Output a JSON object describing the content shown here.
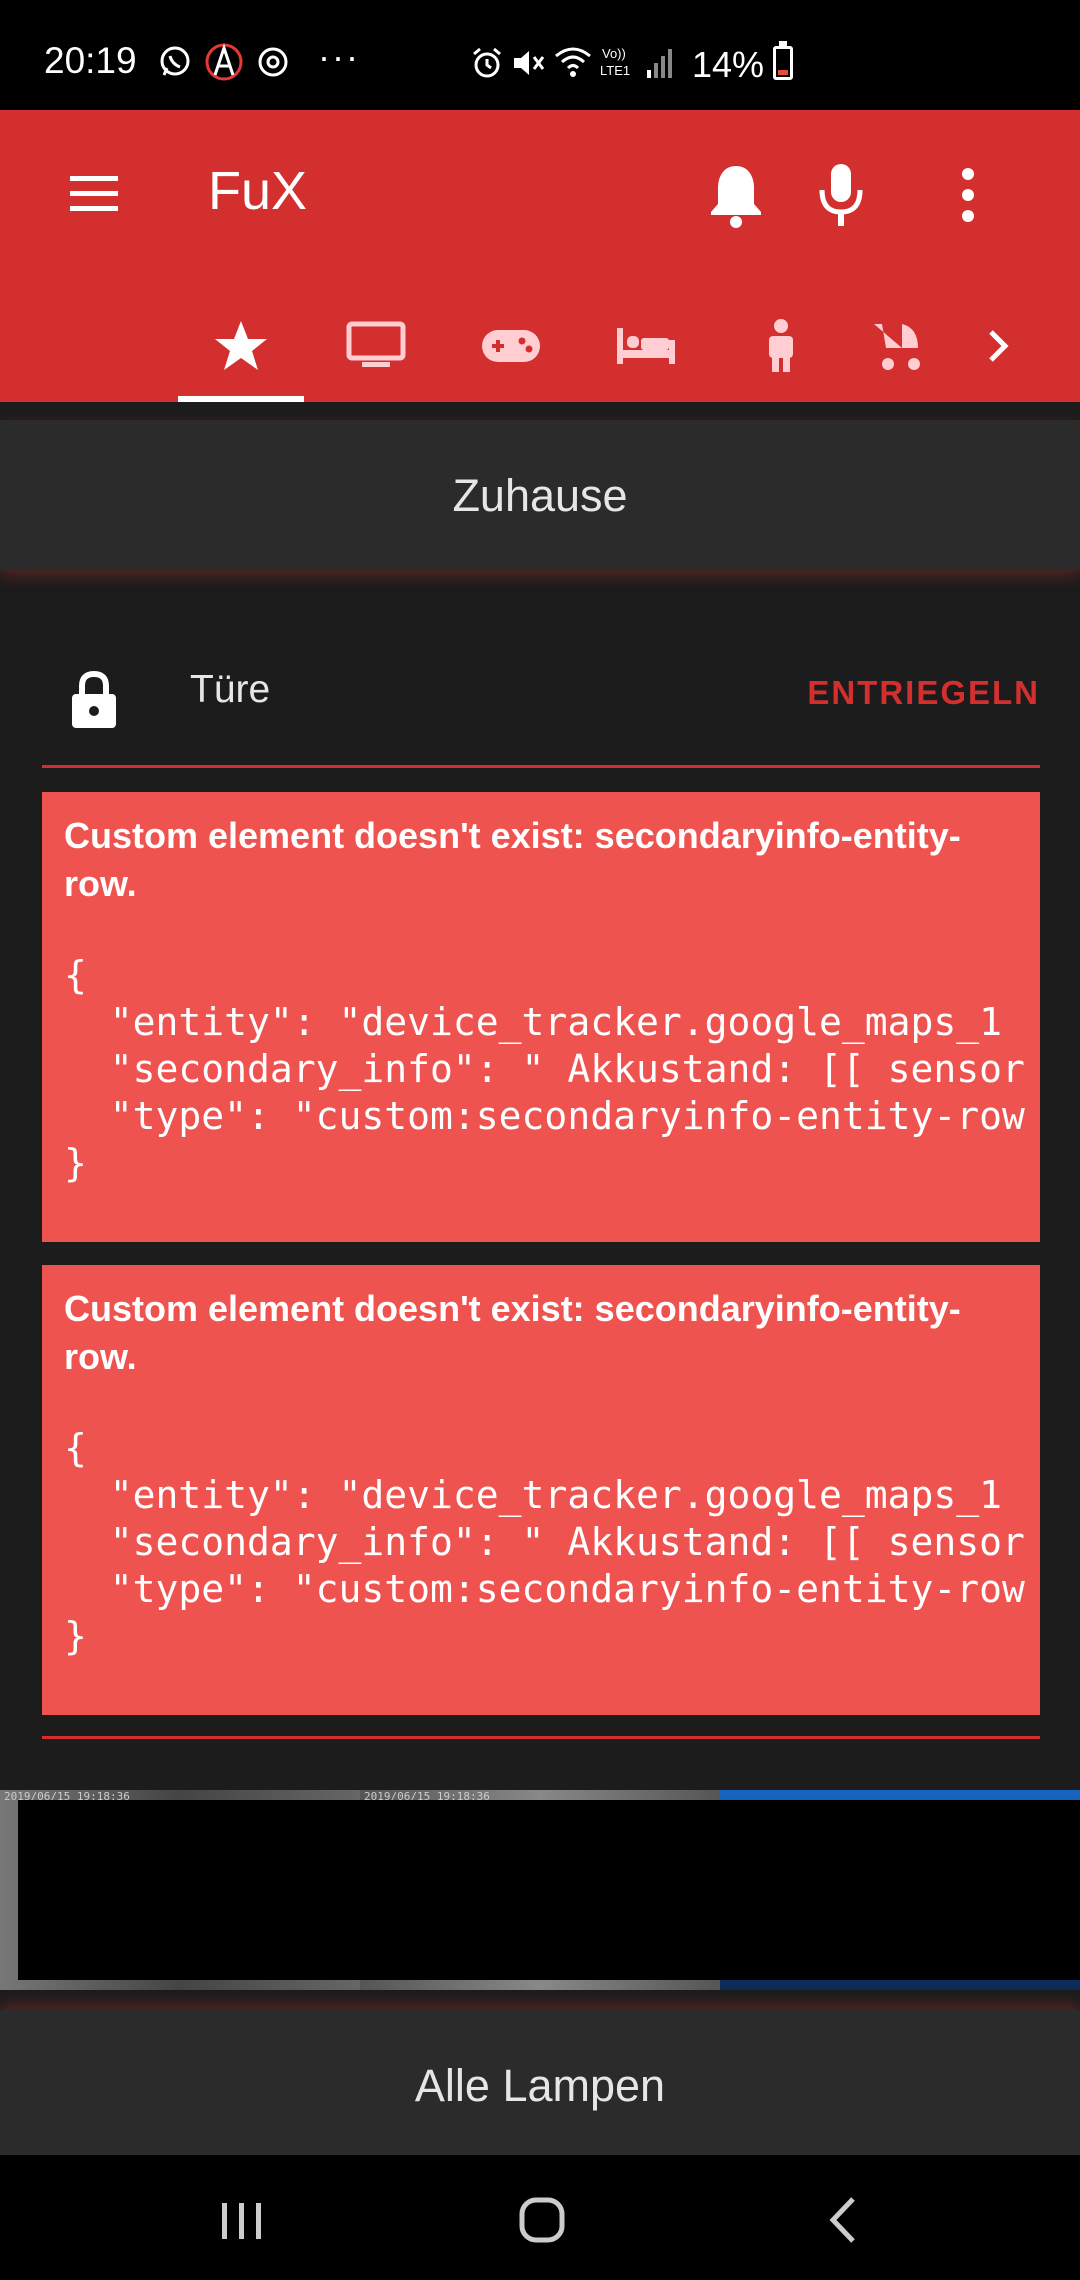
{
  "status_bar": {
    "time": "20:19",
    "dots": "···",
    "battery_text": "14%",
    "icons": [
      "whatsapp-icon",
      "app-a-icon",
      "sync-icon",
      "alarm-icon",
      "mute-icon",
      "wifi-icon",
      "volte-icon",
      "signal-icon",
      "battery-icon"
    ]
  },
  "header": {
    "title": "FuX",
    "icons": [
      "menu-icon",
      "bell-icon",
      "microphone-icon",
      "more-vert-icon"
    ],
    "accent_color": "#d32f2f"
  },
  "tabs": [
    {
      "icon": "star-icon",
      "selected": true
    },
    {
      "icon": "tv-icon",
      "selected": false
    },
    {
      "icon": "gamepad-icon",
      "selected": false
    },
    {
      "icon": "bed-icon",
      "selected": false
    },
    {
      "icon": "child-icon",
      "selected": false
    },
    {
      "icon": "stroller-icon",
      "selected": false
    }
  ],
  "section_title": "Zuhause",
  "lock_row": {
    "label": "Türe",
    "action": "ENTRIEGELN",
    "icon": "lock-icon"
  },
  "error_cards": [
    {
      "title": "Custom element doesn't exist: secondaryinfo-entity-row.",
      "code": "{\n  \"entity\": \"device_tracker.google_maps_1\n  \"secondary_info\": \" Akkustand: [[ sensor\n  \"type\": \"custom:secondaryinfo-entity-row\n}"
    },
    {
      "title": "Custom element doesn't exist: secondaryinfo-entity-row.",
      "code": "{\n  \"entity\": \"device_tracker.google_maps_1\n  \"secondary_info\": \" Akkustand: [[ sensor\n  \"type\": \"custom:secondaryinfo-entity-row\n}"
    }
  ],
  "camera_timestamps": [
    "2019/06/15 19:18:36",
    "2019/06/15 19:18:36"
  ],
  "bottom_title": "Alle Lampen",
  "nav_icons": [
    "recent-apps-icon",
    "home-icon",
    "back-icon"
  ]
}
